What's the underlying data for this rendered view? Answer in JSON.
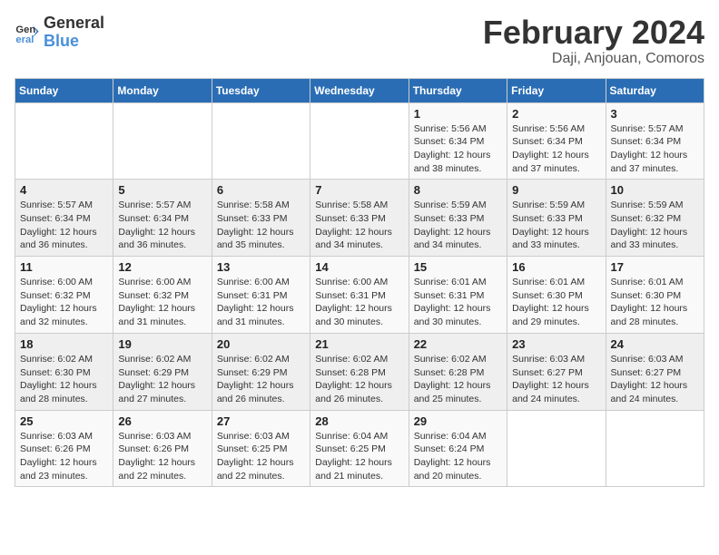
{
  "header": {
    "logo_general": "General",
    "logo_blue": "Blue",
    "title": "February 2024",
    "subtitle": "Daji, Anjouan, Comoros"
  },
  "weekdays": [
    "Sunday",
    "Monday",
    "Tuesday",
    "Wednesday",
    "Thursday",
    "Friday",
    "Saturday"
  ],
  "weeks": [
    [
      {
        "day": "",
        "info": ""
      },
      {
        "day": "",
        "info": ""
      },
      {
        "day": "",
        "info": ""
      },
      {
        "day": "",
        "info": ""
      },
      {
        "day": "1",
        "info": "Sunrise: 5:56 AM\nSunset: 6:34 PM\nDaylight: 12 hours\nand 38 minutes."
      },
      {
        "day": "2",
        "info": "Sunrise: 5:56 AM\nSunset: 6:34 PM\nDaylight: 12 hours\nand 37 minutes."
      },
      {
        "day": "3",
        "info": "Sunrise: 5:57 AM\nSunset: 6:34 PM\nDaylight: 12 hours\nand 37 minutes."
      }
    ],
    [
      {
        "day": "4",
        "info": "Sunrise: 5:57 AM\nSunset: 6:34 PM\nDaylight: 12 hours\nand 36 minutes."
      },
      {
        "day": "5",
        "info": "Sunrise: 5:57 AM\nSunset: 6:34 PM\nDaylight: 12 hours\nand 36 minutes."
      },
      {
        "day": "6",
        "info": "Sunrise: 5:58 AM\nSunset: 6:33 PM\nDaylight: 12 hours\nand 35 minutes."
      },
      {
        "day": "7",
        "info": "Sunrise: 5:58 AM\nSunset: 6:33 PM\nDaylight: 12 hours\nand 34 minutes."
      },
      {
        "day": "8",
        "info": "Sunrise: 5:59 AM\nSunset: 6:33 PM\nDaylight: 12 hours\nand 34 minutes."
      },
      {
        "day": "9",
        "info": "Sunrise: 5:59 AM\nSunset: 6:33 PM\nDaylight: 12 hours\nand 33 minutes."
      },
      {
        "day": "10",
        "info": "Sunrise: 5:59 AM\nSunset: 6:32 PM\nDaylight: 12 hours\nand 33 minutes."
      }
    ],
    [
      {
        "day": "11",
        "info": "Sunrise: 6:00 AM\nSunset: 6:32 PM\nDaylight: 12 hours\nand 32 minutes."
      },
      {
        "day": "12",
        "info": "Sunrise: 6:00 AM\nSunset: 6:32 PM\nDaylight: 12 hours\nand 31 minutes."
      },
      {
        "day": "13",
        "info": "Sunrise: 6:00 AM\nSunset: 6:31 PM\nDaylight: 12 hours\nand 31 minutes."
      },
      {
        "day": "14",
        "info": "Sunrise: 6:00 AM\nSunset: 6:31 PM\nDaylight: 12 hours\nand 30 minutes."
      },
      {
        "day": "15",
        "info": "Sunrise: 6:01 AM\nSunset: 6:31 PM\nDaylight: 12 hours\nand 30 minutes."
      },
      {
        "day": "16",
        "info": "Sunrise: 6:01 AM\nSunset: 6:30 PM\nDaylight: 12 hours\nand 29 minutes."
      },
      {
        "day": "17",
        "info": "Sunrise: 6:01 AM\nSunset: 6:30 PM\nDaylight: 12 hours\nand 28 minutes."
      }
    ],
    [
      {
        "day": "18",
        "info": "Sunrise: 6:02 AM\nSunset: 6:30 PM\nDaylight: 12 hours\nand 28 minutes."
      },
      {
        "day": "19",
        "info": "Sunrise: 6:02 AM\nSunset: 6:29 PM\nDaylight: 12 hours\nand 27 minutes."
      },
      {
        "day": "20",
        "info": "Sunrise: 6:02 AM\nSunset: 6:29 PM\nDaylight: 12 hours\nand 26 minutes."
      },
      {
        "day": "21",
        "info": "Sunrise: 6:02 AM\nSunset: 6:28 PM\nDaylight: 12 hours\nand 26 minutes."
      },
      {
        "day": "22",
        "info": "Sunrise: 6:02 AM\nSunset: 6:28 PM\nDaylight: 12 hours\nand 25 minutes."
      },
      {
        "day": "23",
        "info": "Sunrise: 6:03 AM\nSunset: 6:27 PM\nDaylight: 12 hours\nand 24 minutes."
      },
      {
        "day": "24",
        "info": "Sunrise: 6:03 AM\nSunset: 6:27 PM\nDaylight: 12 hours\nand 24 minutes."
      }
    ],
    [
      {
        "day": "25",
        "info": "Sunrise: 6:03 AM\nSunset: 6:26 PM\nDaylight: 12 hours\nand 23 minutes."
      },
      {
        "day": "26",
        "info": "Sunrise: 6:03 AM\nSunset: 6:26 PM\nDaylight: 12 hours\nand 22 minutes."
      },
      {
        "day": "27",
        "info": "Sunrise: 6:03 AM\nSunset: 6:25 PM\nDaylight: 12 hours\nand 22 minutes."
      },
      {
        "day": "28",
        "info": "Sunrise: 6:04 AM\nSunset: 6:25 PM\nDaylight: 12 hours\nand 21 minutes."
      },
      {
        "day": "29",
        "info": "Sunrise: 6:04 AM\nSunset: 6:24 PM\nDaylight: 12 hours\nand 20 minutes."
      },
      {
        "day": "",
        "info": ""
      },
      {
        "day": "",
        "info": ""
      }
    ]
  ]
}
